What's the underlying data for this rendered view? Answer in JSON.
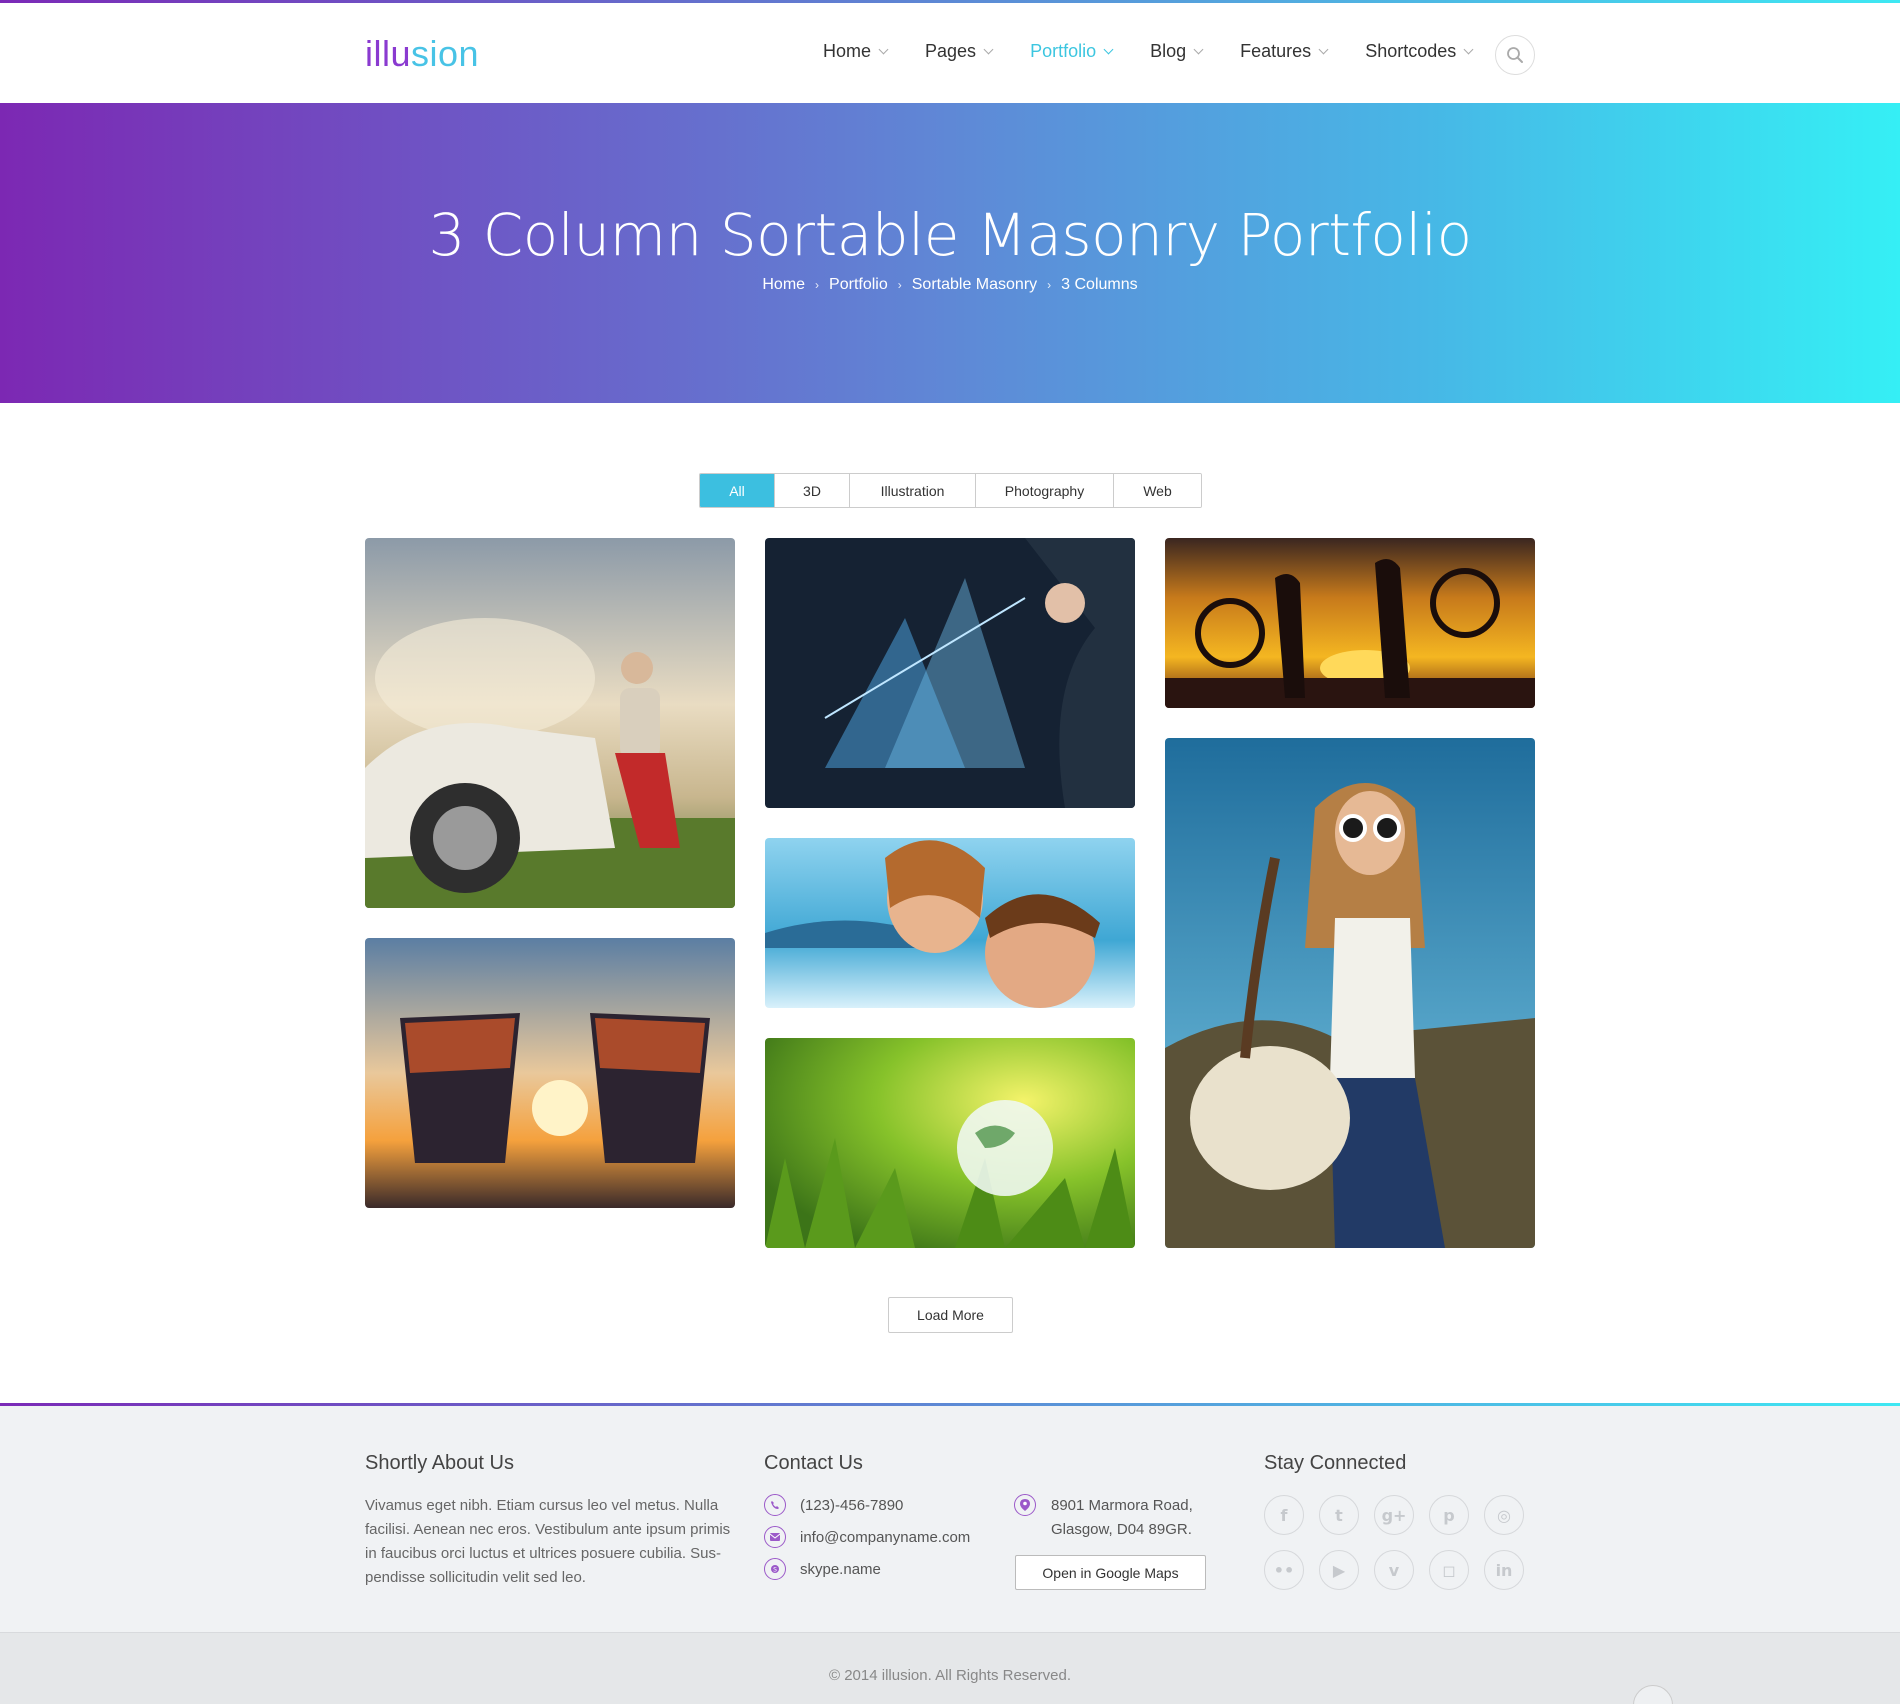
{
  "logo": {
    "part1": "illu",
    "part2": "sion"
  },
  "nav": [
    {
      "label": "Home"
    },
    {
      "label": "Pages"
    },
    {
      "label": "Portfolio"
    },
    {
      "label": "Blog"
    },
    {
      "label": "Features"
    },
    {
      "label": "Shortcodes"
    }
  ],
  "nav_active": "Portfolio",
  "hero": {
    "title": "3 Column Sortable Masonry Portfolio",
    "breadcrumb": [
      "Home",
      "Portfolio",
      "Sortable Masonry",
      "3 Columns"
    ]
  },
  "filters": [
    "All",
    "3D",
    "Illustration",
    "Photography",
    "Web"
  ],
  "filter_active": "All",
  "portfolio_items": [
    {
      "subject": "woman with binoculars in vintage car"
    },
    {
      "subject": "business chart hologram"
    },
    {
      "subject": "cyclists silhouette at sunset"
    },
    {
      "subject": "couple on lounge chairs at sunset beach"
    },
    {
      "subject": "smiling couple by the lake"
    },
    {
      "subject": "glass globe in green grass"
    },
    {
      "subject": "woman with sunglasses and bag"
    }
  ],
  "load_more_label": "Load More",
  "footer": {
    "about": {
      "title": "Shortly About Us",
      "text": "Vivamus eget nibh. Etiam cursus leo vel metus. Nulla facilisi. Aenean nec eros. Vestibulum ante ipsum primis in faucibus orci luctus et ultrices posuere cubilia. Sus-pendisse sollicitudin velit sed leo."
    },
    "contact": {
      "title": "Contact Us",
      "phone": "(123)-456-7890",
      "email": "info@companyname.com",
      "skype": "skype.name",
      "address_line1": "8901 Marmora Road,",
      "address_line2": "Glasgow, D04 89GR.",
      "maps_button": "Open in Google Maps"
    },
    "social": {
      "title": "Stay Connected",
      "icons": [
        "facebook-icon",
        "twitter-icon",
        "google-plus-icon",
        "pinterest-icon",
        "dribbble-icon",
        "flickr-icon",
        "youtube-icon",
        "vimeo-icon",
        "instagram-icon",
        "linkedin-icon"
      ]
    }
  },
  "copyright": "© 2014 illusion. All Rights Reserved.",
  "colors": {
    "accent": "#3cc6e0",
    "brand_purple": "#7b2ab7",
    "brand_cyan": "#35eff5"
  }
}
